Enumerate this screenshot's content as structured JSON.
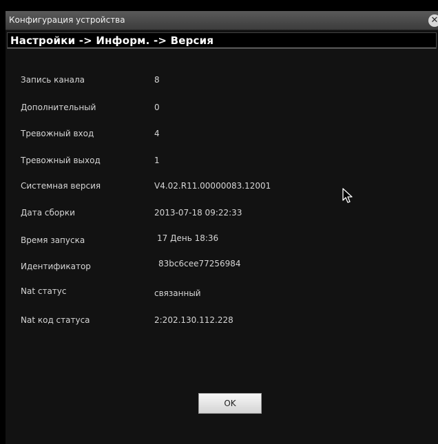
{
  "window": {
    "title": "Конфигурация устройства",
    "close_icon": "close-icon"
  },
  "breadcrumb": "Настройки -> Информ. -> Версия",
  "info_rows": [
    {
      "label": "Запись канала",
      "value": "8"
    },
    {
      "label": "Дополнительный",
      "value": "0"
    },
    {
      "label": "Тревожный вход",
      "value": "4"
    },
    {
      "label": "Тревожный выход",
      "value": "1"
    },
    {
      "label": "Системная версия",
      "value": "V4.02.R11.00000083.12001"
    },
    {
      "label": "Дата сборки",
      "value": "2013-07-18 09:22:33"
    },
    {
      "label": "Время запуска",
      "value": "17 День 18:36"
    },
    {
      "label": "Идентификатор",
      "value": "83bc6cee77256984"
    },
    {
      "label": "Nat статус",
      "value": "связанный"
    },
    {
      "label": "Nat код статуса",
      "value": "2:202.130.112.228"
    }
  ],
  "ok_button": {
    "label": "OK"
  },
  "cursor": "mouse-pointer-icon",
  "colors": {
    "background": "#121212",
    "titlebar": "#4a4a4a",
    "text": "#d6d6d6"
  }
}
